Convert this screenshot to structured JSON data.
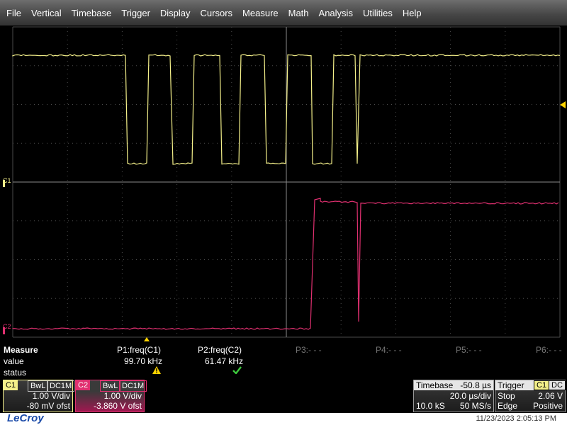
{
  "menu": [
    "File",
    "Vertical",
    "Timebase",
    "Trigger",
    "Display",
    "Cursors",
    "Measure",
    "Math",
    "Analysis",
    "Utilities",
    "Help"
  ],
  "colors": {
    "c1": "#f4f08a",
    "c2": "#e03070",
    "grid": "#4a4a4a",
    "accent": "#ffd400"
  },
  "markers": {
    "c1": "C1",
    "c2": "C2"
  },
  "measure": {
    "title": "Measure",
    "row_value": "value",
    "row_status": "status",
    "p1": {
      "label": "P1:freq(C1)",
      "value": "99.70 kHz",
      "status_icon": "warning-triangle"
    },
    "p2": {
      "label": "P2:freq(C2)",
      "value": "61.47 kHz",
      "status_icon": "check-mark"
    },
    "p3": "P3:- - -",
    "p4": "P4:- - -",
    "p5": "P5:- - -",
    "p6": "P6:- - -"
  },
  "c1_desc": {
    "name": "C1",
    "bw": "BwL",
    "coupling": "DC1M",
    "vdiv": "1.00 V/div",
    "offset": "-80 mV ofst"
  },
  "c2_desc": {
    "name": "C2",
    "bw": "BwL",
    "coupling": "DC1M",
    "vdiv": "1.00 V/div",
    "offset": "-3.860 V ofst"
  },
  "timebase": {
    "label": "Timebase",
    "delay": "-50.8 µs",
    "tdiv": "20.0 µs/div",
    "samples": "10.0 kS",
    "rate": "50 MS/s"
  },
  "trigger": {
    "label": "Trigger",
    "source": "C1",
    "coupling": "DC",
    "mode": "Stop",
    "level": "2.06 V",
    "type": "Edge",
    "slope": "Positive"
  },
  "footer": {
    "logo": "LeCroy",
    "datetime": "11/23/2023 2:05:13 PM"
  }
}
